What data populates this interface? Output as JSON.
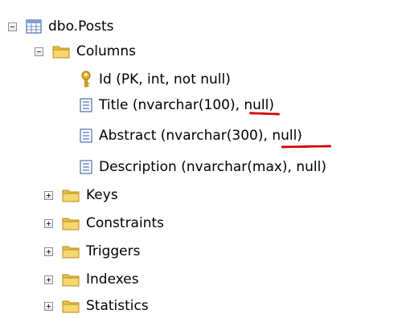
{
  "tree": {
    "table": {
      "label": "dbo.Posts",
      "expanded": true
    },
    "columns_folder": {
      "label": "Columns",
      "expanded": true
    },
    "columns": [
      {
        "label": "Id (PK, int, not null)",
        "icon": "key-icon"
      },
      {
        "label": "Title (nvarchar(100), null)",
        "icon": "column-icon"
      },
      {
        "label": "Abstract (nvarchar(300), null)",
        "icon": "column-icon"
      },
      {
        "label": "Description (nvarchar(max), null)",
        "icon": "column-icon"
      }
    ],
    "folders": [
      {
        "label": "Keys",
        "expanded": false
      },
      {
        "label": "Constraints",
        "expanded": false
      },
      {
        "label": "Triggers",
        "expanded": false
      },
      {
        "label": "Indexes",
        "expanded": false
      },
      {
        "label": "Statistics",
        "expanded": false
      }
    ]
  },
  "colors": {
    "folder": "#e8c24a",
    "key": "#d9a21b",
    "column_icon": "#4a6fb5",
    "annotation": "#d20000"
  }
}
